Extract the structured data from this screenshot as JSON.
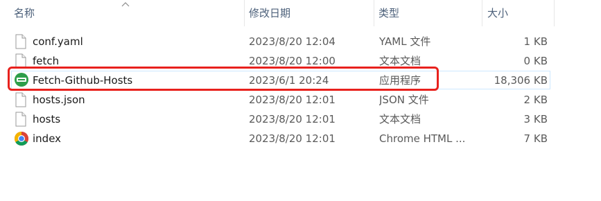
{
  "columns": {
    "name": "名称",
    "date": "修改日期",
    "type": "类型",
    "size": "大小"
  },
  "files": [
    {
      "name": "conf.yaml",
      "date": "2023/8/20 12:04",
      "type": "YAML 文件",
      "size": "1 KB",
      "icon": "blank-file-icon"
    },
    {
      "name": "fetch",
      "date": "2023/8/20 12:00",
      "type": "文本文档",
      "size": "0 KB",
      "icon": "blank-file-icon"
    },
    {
      "name": "Fetch-Github-Hosts",
      "date": "2023/6/1 20:24",
      "type": "应用程序",
      "size": "18,306 KB",
      "icon": "app-icon"
    },
    {
      "name": "hosts.json",
      "date": "2023/8/20 12:01",
      "type": "JSON 文件",
      "size": "2 KB",
      "icon": "blank-file-icon"
    },
    {
      "name": "hosts",
      "date": "2023/8/20 12:01",
      "type": "文本文档",
      "size": "3 KB",
      "icon": "blank-file-icon"
    },
    {
      "name": "index",
      "date": "2023/8/20 12:01",
      "type": "Chrome HTML ...",
      "size": "7 KB",
      "icon": "chrome-icon"
    }
  ],
  "colors": {
    "highlight": "#e8211d",
    "header_text": "#4c607a",
    "app_icon_green": "#2e9e4a"
  }
}
